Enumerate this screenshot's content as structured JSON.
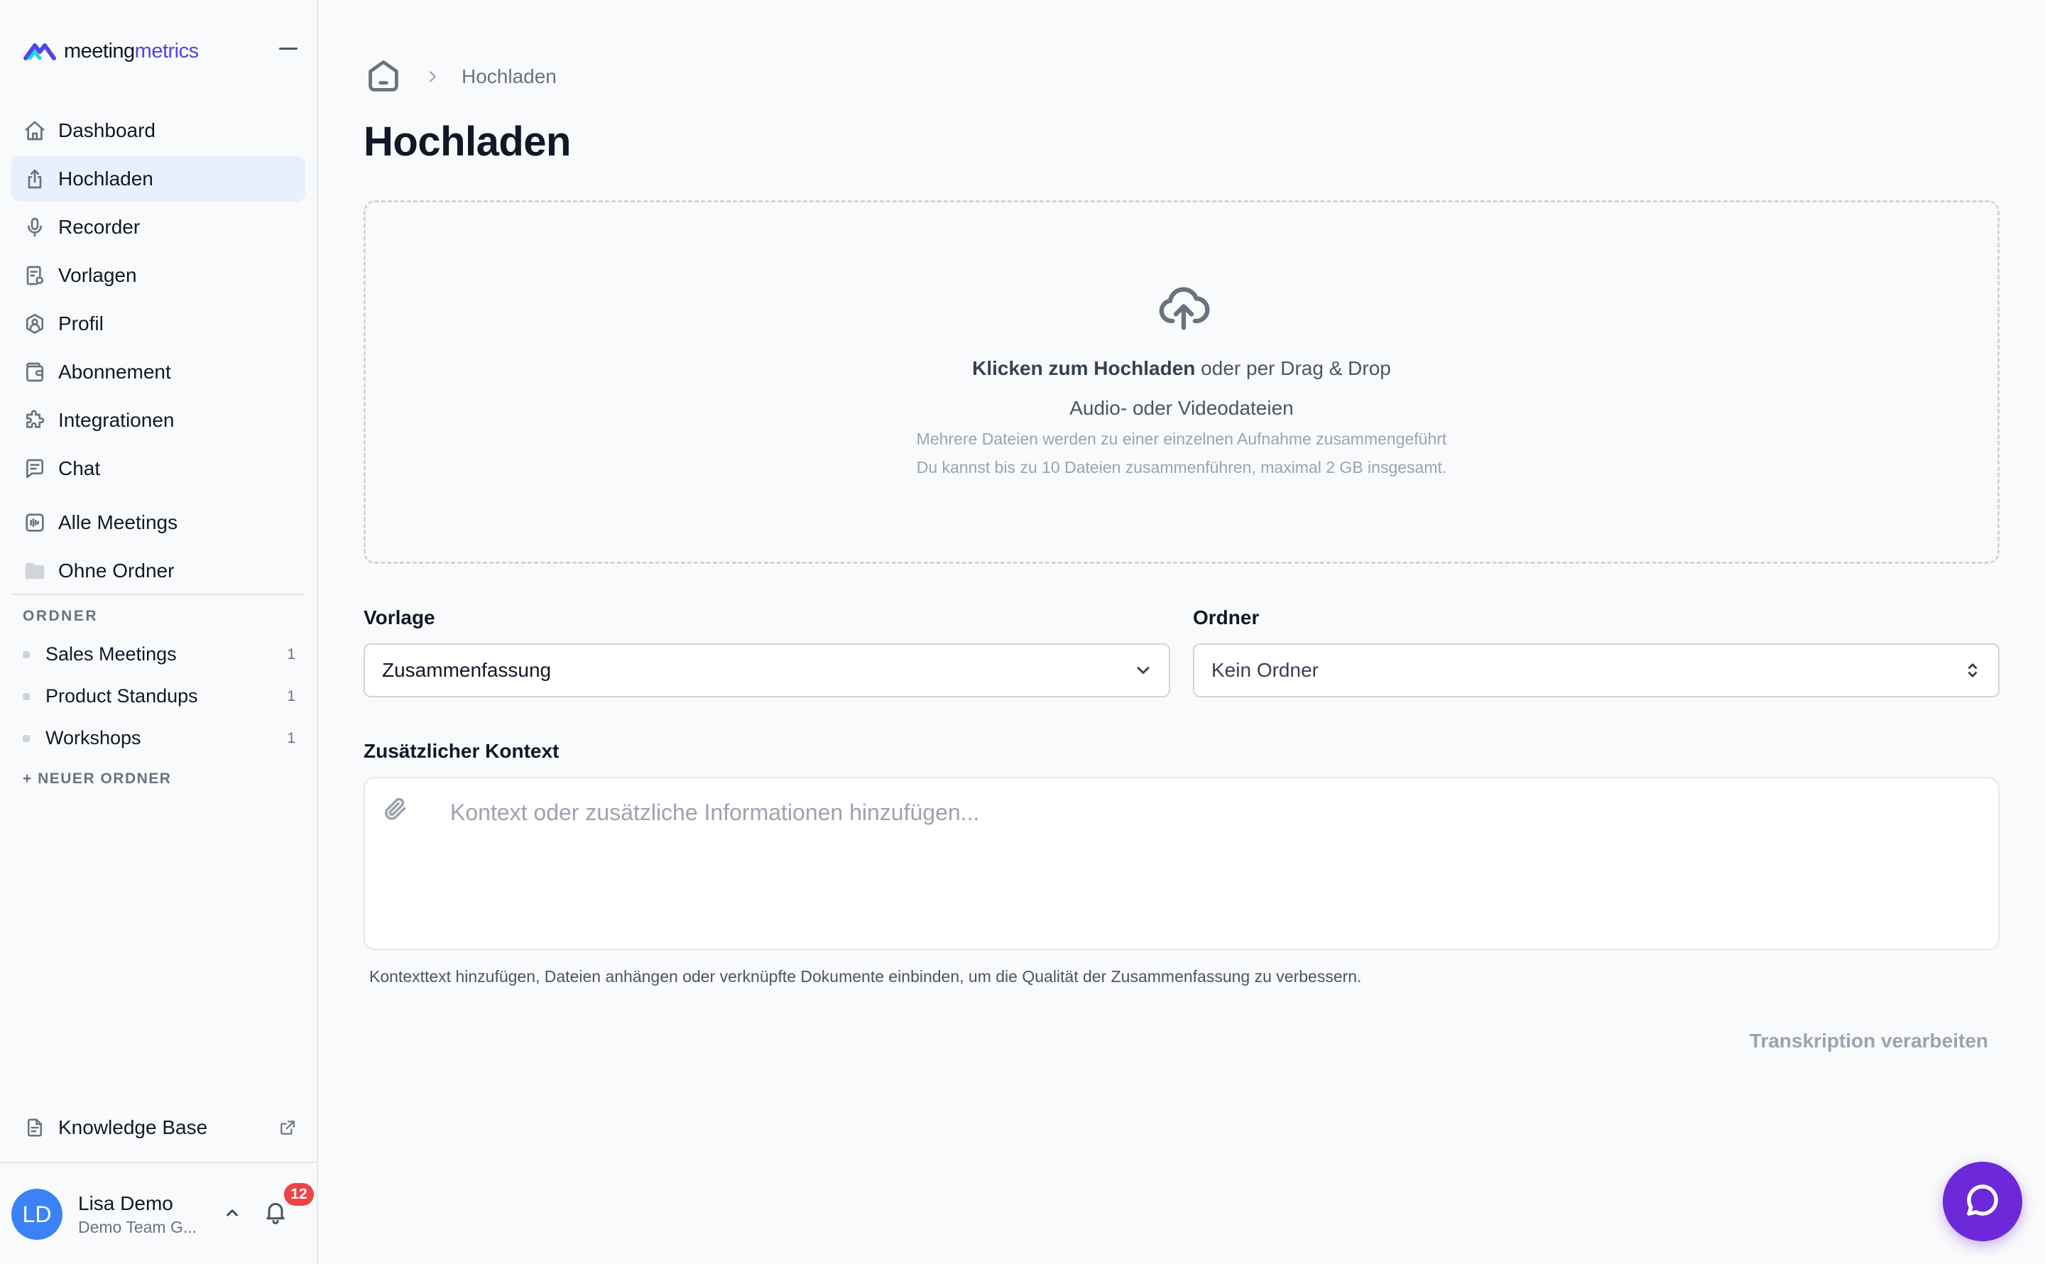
{
  "app": {
    "logo_part1": "meeting",
    "logo_part2": "metrics",
    "brand_color": "#4f46e5",
    "accent_color": "#6d28d9"
  },
  "sidebar": {
    "nav": [
      {
        "label": "Dashboard",
        "icon": "home-icon",
        "active": false
      },
      {
        "label": "Hochladen",
        "icon": "upload-icon",
        "active": true
      },
      {
        "label": "Recorder",
        "icon": "microphone-icon",
        "active": false
      },
      {
        "label": "Vorlagen",
        "icon": "template-icon",
        "active": false
      },
      {
        "label": "Profil",
        "icon": "user-settings-icon",
        "active": false
      },
      {
        "label": "Abonnement",
        "icon": "wallet-icon",
        "active": false
      },
      {
        "label": "Integrationen",
        "icon": "puzzle-icon",
        "active": false
      },
      {
        "label": "Chat",
        "icon": "chat-icon",
        "active": false
      },
      {
        "label": "Alle Meetings",
        "icon": "audio-wave-icon",
        "active": false
      },
      {
        "label": "Ohne Ordner",
        "icon": "folder-icon",
        "active": false
      }
    ],
    "section_label": "ORDNER",
    "folders": [
      {
        "name": "Sales Meetings",
        "count": "1"
      },
      {
        "name": "Product Standups",
        "count": "1"
      },
      {
        "name": "Workshops",
        "count": "1"
      }
    ],
    "new_folder_label": "+ NEUER ORDNER",
    "knowledge_base_label": "Knowledge Base",
    "user": {
      "initials": "LD",
      "name": "Lisa Demo",
      "team": "Demo Team G...",
      "notification_count": "12"
    }
  },
  "main": {
    "breadcrumb_current": "Hochladen",
    "title": "Hochladen",
    "dropzone": {
      "primary_bold": "Klicken zum Hochladen",
      "primary_rest": " oder per Drag & Drop",
      "secondary": "Audio- oder Videodateien",
      "hint1": "Mehrere Dateien werden zu einer einzelnen Aufnahme zusammengeführt",
      "hint2": "Du kannst bis zu 10 Dateien zusammenführen, maximal 2 GB insgesamt."
    },
    "template": {
      "label": "Vorlage",
      "value": "Zusammenfassung"
    },
    "folder": {
      "label": "Ordner",
      "value": "Kein Ordner"
    },
    "context": {
      "label": "Zusätzlicher Kontext",
      "placeholder": "Kontext oder zusätzliche Informationen hinzufügen...",
      "value": "",
      "helper": "Kontexttext hinzufügen, Dateien anhängen oder verknüpfte Dokumente einbinden, um die Qualität der Zusammenfassung zu verbessern."
    },
    "submit_label": "Transkription verarbeiten"
  }
}
